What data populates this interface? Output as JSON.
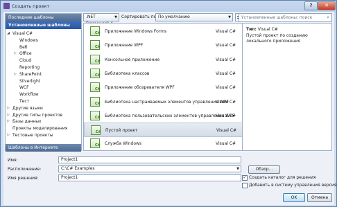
{
  "window": {
    "title": "Создать проект",
    "help_glyph": "?",
    "close_glyph": "✕"
  },
  "left_pane": {
    "recent": "Последние шаблоны",
    "installed": "Установленные шаблоны",
    "online": "Шаблоны в Интернете",
    "tree": [
      {
        "label": "Visual C#",
        "arrow": "◢",
        "level": 0
      },
      {
        "label": "Windows",
        "arrow": "",
        "level": 1
      },
      {
        "label": "Веб",
        "arrow": "",
        "level": 1
      },
      {
        "label": "Office",
        "arrow": "▷",
        "level": 1
      },
      {
        "label": "Cloud",
        "arrow": "",
        "level": 1
      },
      {
        "label": "Reporting",
        "arrow": "",
        "level": 1
      },
      {
        "label": "SharePoint",
        "arrow": "▷",
        "level": 1
      },
      {
        "label": "Silverlight",
        "arrow": "",
        "level": 1
      },
      {
        "label": "WCF",
        "arrow": "",
        "level": 1
      },
      {
        "label": "Workflow",
        "arrow": "",
        "level": 1
      },
      {
        "label": "Тест",
        "arrow": "",
        "level": 1
      },
      {
        "label": "Другие языки",
        "arrow": "▷",
        "level": 0
      },
      {
        "label": "Другие типы проектов",
        "arrow": "▷",
        "level": 0
      },
      {
        "label": "Базы данных",
        "arrow": "▷",
        "level": 0
      },
      {
        "label": "Проекты моделирования",
        "arrow": "",
        "level": 0
      },
      {
        "label": "Тестовые проекты",
        "arrow": "▷",
        "level": 0
      }
    ]
  },
  "toolbar": {
    "framework": ".NET Framework 4",
    "sort_label": "Сортировать по:",
    "sort_value": "По умолчанию",
    "search_placeholder": "Установленные шаблоны: поиск"
  },
  "templates": [
    {
      "name": "Приложение Windows Forms",
      "lang": "Visual C#"
    },
    {
      "name": "Приложение WPF",
      "lang": "Visual C#"
    },
    {
      "name": "Консольное приложение",
      "lang": "Visual C#"
    },
    {
      "name": "Библиотека классов",
      "lang": "Visual C#"
    },
    {
      "name": "Приложение обозревателя WPF",
      "lang": "Visual C#"
    },
    {
      "name": "Библиотека настраиваемых элементов управления WPF",
      "lang": "Visual C#"
    },
    {
      "name": "Библиотека пользовательских элементов управления WPF",
      "lang": "Visual C#"
    },
    {
      "name": "Пустой проект",
      "lang": "Visual C#",
      "selected": true
    },
    {
      "name": "Служба Windows",
      "lang": "Visual C#"
    }
  ],
  "info": {
    "type_label": "Тип:",
    "type_value": "Visual C#",
    "description": "Пустой проект по созданию локального приложения"
  },
  "form": {
    "name_label": "Имя:",
    "name_value": "Project1",
    "location_label": "Расположение:",
    "location_value": "C:\\C# Examples",
    "solution_label": "Имя решения:",
    "solution_value": "Project1",
    "browse_label": "Обзор...",
    "create_dir_label": "Создать каталог для решения",
    "create_dir_checked": true,
    "vcs_label": "Добавить в систему управления версиями",
    "vcs_checked": false
  },
  "buttons": {
    "ok": "OK",
    "cancel": "Отмена"
  }
}
